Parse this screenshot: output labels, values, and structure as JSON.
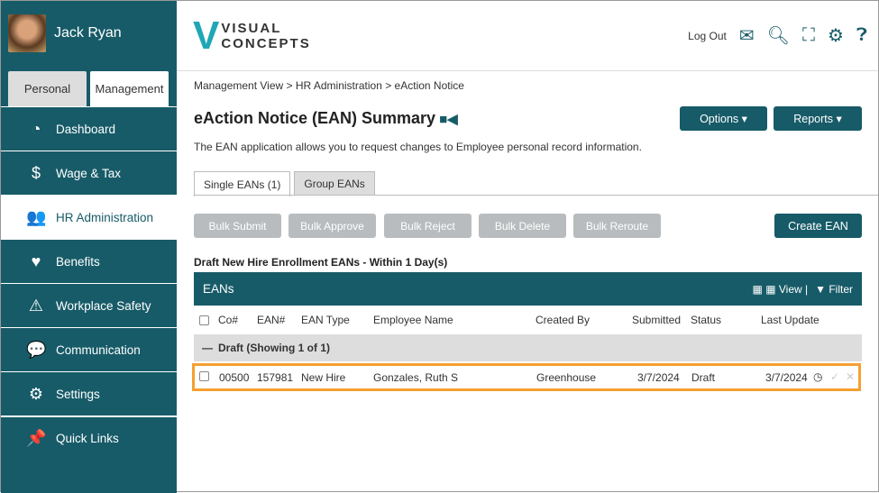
{
  "user": {
    "name": "Jack Ryan"
  },
  "side_tabs": [
    "Personal",
    "Management"
  ],
  "menu": [
    {
      "label": "Dashboard",
      "icon": "gauge-icon",
      "glyph": "◔"
    },
    {
      "label": "Wage & Tax",
      "icon": "dollar-icon",
      "glyph": "$"
    },
    {
      "label": "HR Administration",
      "icon": "users-icon",
      "glyph": "👥"
    },
    {
      "label": "Benefits",
      "icon": "heart-icon",
      "glyph": "♥"
    },
    {
      "label": "Workplace Safety",
      "icon": "warning-icon",
      "glyph": "⚠"
    },
    {
      "label": "Communication",
      "icon": "chat-icon",
      "glyph": "💬"
    },
    {
      "label": "Settings",
      "icon": "gear-icon",
      "glyph": "⚙"
    },
    {
      "label": "Quick Links",
      "icon": "pin-icon",
      "glyph": "📌"
    }
  ],
  "logo": {
    "line1": "VISUAL",
    "line2": "CONCEPTS"
  },
  "header": {
    "logout": "Log Out"
  },
  "breadcrumb": "Management View > HR Administration > eAction Notice",
  "title": "eAction Notice (EAN) Summary",
  "description": "The EAN application allows you to request changes to Employee personal record information.",
  "buttons": {
    "options": "Options ▾",
    "reports": "Reports ▾",
    "create": "Create EAN"
  },
  "tabs": [
    "Single EANs (1)",
    "Group EANs"
  ],
  "bulk": [
    "Bulk Submit",
    "Bulk Approve",
    "Bulk Reject",
    "Bulk Delete",
    "Bulk Reroute"
  ],
  "section_title": "Draft New Hire Enrollment EANs - Within 1 Day(s)",
  "table": {
    "title": "EANs",
    "view": "View |",
    "filter": "Filter",
    "columns": [
      "Co#",
      "EAN#",
      "EAN Type",
      "Employee Name",
      "Created By",
      "Submitted",
      "Status",
      "Last Update"
    ],
    "group": "Draft (Showing 1 of 1)",
    "rows": [
      {
        "co": "00500",
        "ean": "157981",
        "type": "New Hire",
        "name": "Gonzales, Ruth S",
        "created_by": "Greenhouse",
        "submitted": "3/7/2024",
        "status": "Draft",
        "last_update": "3/7/2024"
      }
    ]
  },
  "colors": {
    "primary": "#175b68",
    "highlight": "#f5a030"
  }
}
